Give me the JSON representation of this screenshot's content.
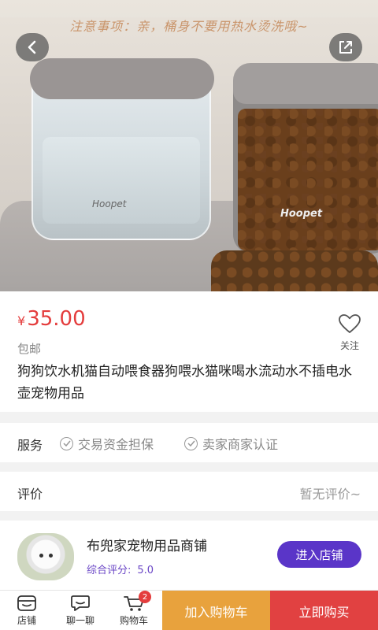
{
  "hero": {
    "banner": "注意事项：亲，桶身不要用热水烫洗哦~",
    "brand_left": "Hoopet",
    "brand_right": "Hoopet"
  },
  "product": {
    "currency": "¥",
    "price": "35.00",
    "shipping": "包邮",
    "follow_label": "关注",
    "title": "狗狗饮水机猫自动喂食器狗喂水猫咪喝水流动水不插电水壶宠物用品"
  },
  "service": {
    "label": "服务",
    "items": [
      "交易资金担保",
      "卖家商家认证"
    ]
  },
  "review": {
    "label": "评价",
    "value": "暂无评价~"
  },
  "shop": {
    "name": "布兜家宠物用品商铺",
    "score_label": "综合评分:",
    "score_value": "5.0",
    "enter_label": "进入店铺"
  },
  "bottom_bar": {
    "tabs": [
      {
        "label": "店铺",
        "icon": "store-icon"
      },
      {
        "label": "聊一聊",
        "icon": "chat-icon"
      },
      {
        "label": "购物车",
        "icon": "cart-icon",
        "badge": "2"
      }
    ],
    "add_to_cart": "加入购物车",
    "buy_now": "立即购买"
  },
  "colors": {
    "price": "#e43d3d",
    "accent": "#5a35c8",
    "add_cart": "#e8a23d",
    "buy_now": "#e14141"
  }
}
